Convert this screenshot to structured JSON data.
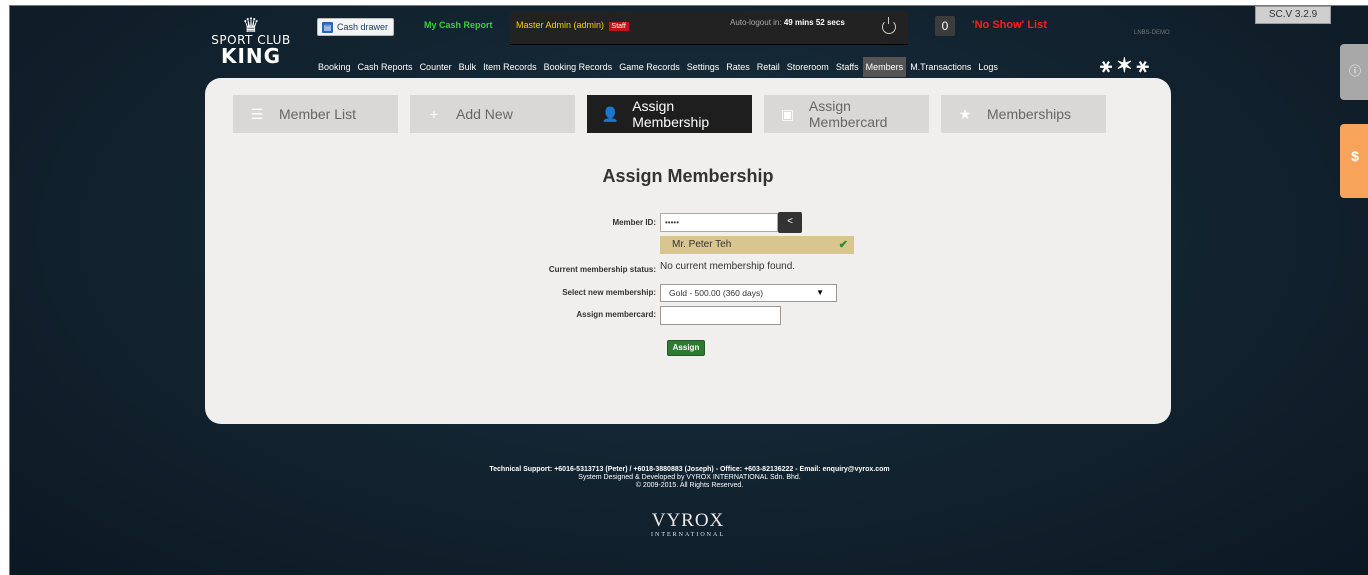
{
  "header": {
    "logo": {
      "line1": "SPORT CLUB",
      "line2": "KING"
    },
    "cash_drawer": "Cash drawer",
    "my_cash_report": "My Cash Report",
    "admin": "Master Admin (admin)",
    "staff_badge": "Staff",
    "autologout_label": "Auto-logout in:",
    "autologout_time": "49 mins 52 secs",
    "counter": "0",
    "no_show": "'No Show' List",
    "server": "LNBS-DEMO",
    "version": "SC.V 3.2.9"
  },
  "nav": {
    "items": [
      "Booking",
      "Cash Reports",
      "Counter",
      "Bulk",
      "Item Records",
      "Booking Records",
      "Game Records",
      "Settings",
      "Rates",
      "Retail",
      "Storeroom",
      "Staffs",
      "Members",
      "M.Transactions",
      "Logs"
    ],
    "active": "Members"
  },
  "tabs": [
    {
      "label": "Member List",
      "icon": "list-icon",
      "active": false
    },
    {
      "label": "Add New",
      "icon": "plus-icon",
      "active": false
    },
    {
      "label": "Assign Membership",
      "icon": "user-icon",
      "active": true
    },
    {
      "label": "Assign Membercard",
      "icon": "card-icon",
      "active": false
    },
    {
      "label": "Memberships",
      "icon": "star-icon",
      "active": false
    }
  ],
  "form": {
    "title": "Assign Membership",
    "member_id_label": "Member ID:",
    "member_id_value": "•••••",
    "back_label": "<",
    "member_name": "Mr. Peter Teh",
    "status_label": "Current membership status:",
    "status_value": "No current membership found.",
    "select_label": "Select new membership:",
    "select_value": "Gold - 500.00 (360 days)",
    "card_label": "Assign membercard:",
    "card_value": "",
    "assign_button": "Assign"
  },
  "footer": {
    "support": "Technical Support: +6016-5313713 (Peter) / +6018-3880883 (Joseph) - Office: +603-82136222 - Email: enquiry@vyrox.com",
    "designed": "System Designed & Developed by VYROX INTERNATIONAL Sdn. Bhd.",
    "copyright": "© 2009-2015. All Rights Reserved.",
    "brand": "VYROX",
    "brand_sub": "INTERNATIONAL"
  },
  "colors": {
    "accent_green": "#2f7a33",
    "no_show_red": "#ff1d1d",
    "member_highlight": "#d9c58f",
    "side_tab_orange": "#f7a45a"
  }
}
